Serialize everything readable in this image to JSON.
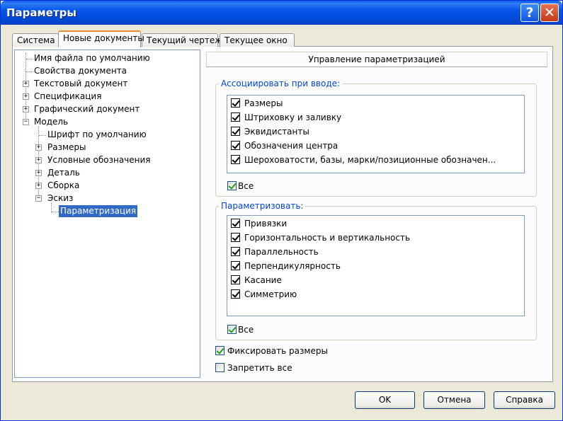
{
  "window": {
    "title": "Параметры",
    "help_glyph": "?",
    "close_glyph": "✕"
  },
  "tabs": [
    {
      "label": "Система"
    },
    {
      "label": "Новые документы"
    },
    {
      "label": "Текущий чертеж"
    },
    {
      "label": "Текущее окно"
    }
  ],
  "tree": {
    "items": [
      {
        "label": "Имя файла по умолчанию"
      },
      {
        "label": "Свойства документа"
      },
      {
        "label": "Текстовый документ"
      },
      {
        "label": "Спецификация"
      },
      {
        "label": "Графический документ"
      },
      {
        "label": "Модель"
      },
      {
        "label": "Шрифт по умолчанию"
      },
      {
        "label": "Размеры"
      },
      {
        "label": "Условные обозначения"
      },
      {
        "label": "Деталь"
      },
      {
        "label": "Сборка"
      },
      {
        "label": "Эскиз"
      },
      {
        "label": "Параметризация"
      }
    ]
  },
  "section_title": "Управление параметризацией",
  "associate": {
    "label": "Ассоциировать при вводе:",
    "items": [
      {
        "label": "Размеры",
        "checked": true
      },
      {
        "label": "Штриховку и заливку",
        "checked": true
      },
      {
        "label": "Эквидистанты",
        "checked": true
      },
      {
        "label": "Обозначения центра",
        "checked": true
      },
      {
        "label": "Шероховатости, базы, марки/позиционные обозначен...",
        "checked": true
      }
    ],
    "all_label": "Все"
  },
  "parametrize": {
    "label": "Параметризовать:",
    "items": [
      {
        "label": "Привязки",
        "checked": true
      },
      {
        "label": "Горизонтальность и вертикальность",
        "checked": true
      },
      {
        "label": "Параллельность",
        "checked": true
      },
      {
        "label": "Перпендикулярность",
        "checked": true
      },
      {
        "label": "Касание",
        "checked": true
      },
      {
        "label": "Симметрию",
        "checked": true
      }
    ],
    "all_label": "Все"
  },
  "fix_sizes": {
    "label": "Фиксировать размеры",
    "checked": true
  },
  "forbid_all": {
    "label": "Запретить все",
    "checked": false
  },
  "buttons": {
    "ok": "OK",
    "cancel": "Отмена",
    "help": "Справка"
  },
  "colors": {
    "title_bar": "#0556e8",
    "selection": "#316ac5",
    "group_label": "#0046d5",
    "check_green": "#21a121"
  }
}
